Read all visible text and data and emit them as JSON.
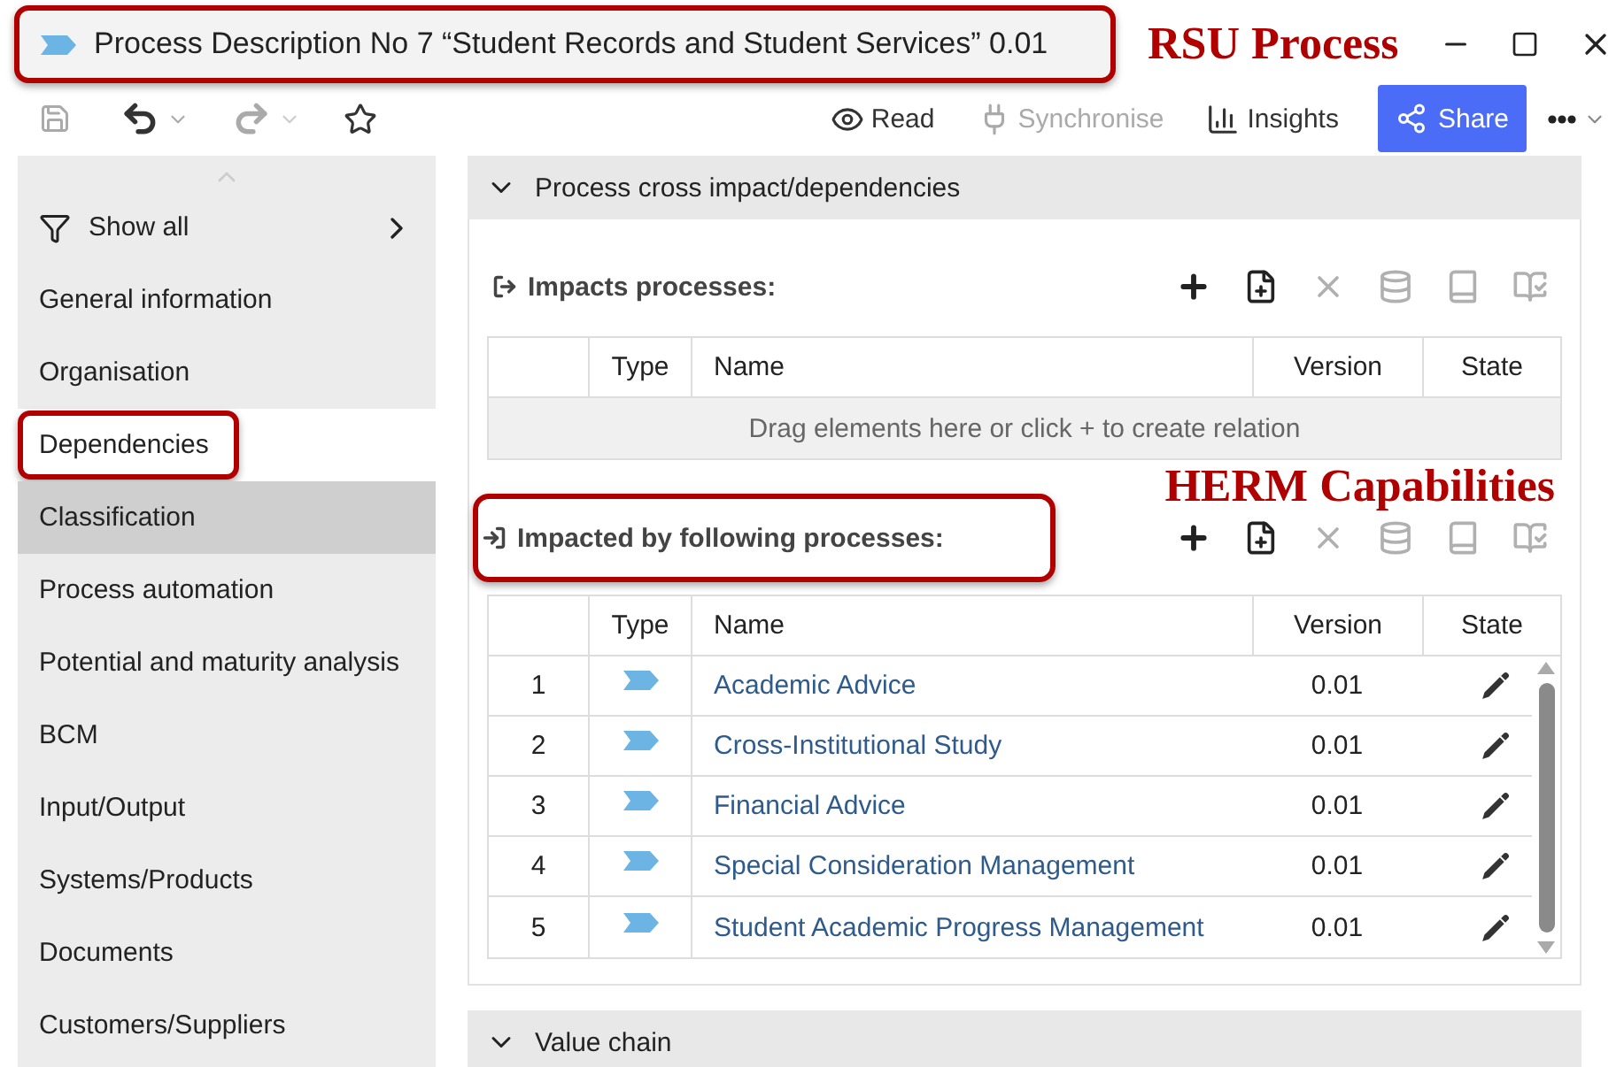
{
  "window": {
    "title": "Process Description No 7 “Student Records and Student Services” 0.01",
    "highlighted": true,
    "annotation": "RSU Process"
  },
  "toolbar": {
    "save_disabled": true,
    "undo_disabled": false,
    "redo_disabled": true,
    "actions": [
      {
        "kind": "read",
        "label": "Read",
        "disabled": false
      },
      {
        "kind": "sync",
        "label": "Synchronise",
        "disabled": true
      },
      {
        "kind": "insights",
        "label": "Insights",
        "disabled": false
      }
    ],
    "share": "Share"
  },
  "sidebar": {
    "show_all": "Show all",
    "items": [
      {
        "label": "General information",
        "selected": false,
        "hovered": false,
        "highlighted": false
      },
      {
        "label": "Organisation",
        "selected": false,
        "hovered": false,
        "highlighted": false
      },
      {
        "label": "Dependencies",
        "selected": true,
        "hovered": false,
        "highlighted": true
      },
      {
        "label": "Classification",
        "selected": false,
        "hovered": true,
        "highlighted": false
      },
      {
        "label": "Process automation",
        "selected": false,
        "hovered": false,
        "highlighted": false
      },
      {
        "label": "Potential and maturity analysis",
        "selected": false,
        "hovered": false,
        "highlighted": false
      },
      {
        "label": "BCM",
        "selected": false,
        "hovered": false,
        "highlighted": false
      },
      {
        "label": "Input/Output",
        "selected": false,
        "hovered": false,
        "highlighted": false
      },
      {
        "label": "Systems/Products",
        "selected": false,
        "hovered": false,
        "highlighted": false
      },
      {
        "label": "Documents",
        "selected": false,
        "hovered": false,
        "highlighted": false
      },
      {
        "label": "Customers/Suppliers",
        "selected": false,
        "hovered": false,
        "highlighted": false
      }
    ]
  },
  "sections": [
    {
      "title": "Process cross impact/dependencies",
      "expanded": true,
      "groups": [
        {
          "kind": "outgoing",
          "title": "Impacts processes:",
          "highlighted": false,
          "actions": [
            {
              "kind": "add",
              "disabled": false
            },
            {
              "kind": "new",
              "disabled": false
            },
            {
              "kind": "remove",
              "disabled": true
            },
            {
              "kind": "db",
              "disabled": true
            },
            {
              "kind": "book",
              "disabled": true
            },
            {
              "kind": "bookedit",
              "disabled": true
            }
          ],
          "columns": [
            "Type",
            "Name",
            "Version",
            "State"
          ],
          "empty_text": "Drag elements here or click + to create relation"
        },
        {
          "kind": "incoming",
          "title": "Impacted by following processes:",
          "highlighted": true,
          "annotation": "HERM Capabilities",
          "actions": [
            {
              "kind": "add",
              "disabled": false
            },
            {
              "kind": "new",
              "disabled": false
            },
            {
              "kind": "remove",
              "disabled": true
            },
            {
              "kind": "db",
              "disabled": true
            },
            {
              "kind": "book",
              "disabled": true
            },
            {
              "kind": "bookedit",
              "disabled": true
            }
          ],
          "columns": [
            "Type",
            "Name",
            "Version",
            "State"
          ],
          "rows": [
            {
              "number": "1",
              "name": "Academic Advice",
              "version": "0.01"
            },
            {
              "number": "2",
              "name": "Cross-Institutional Study",
              "version": "0.01"
            },
            {
              "number": "3",
              "name": "Financial Advice",
              "version": "0.01"
            },
            {
              "number": "4",
              "name": "Special Consideration Management",
              "version": "0.01"
            },
            {
              "number": "5",
              "name": "Student Academic Progress Management",
              "version": "0.01"
            }
          ]
        }
      ]
    },
    {
      "title": "Value chain",
      "expanded": true
    }
  ]
}
